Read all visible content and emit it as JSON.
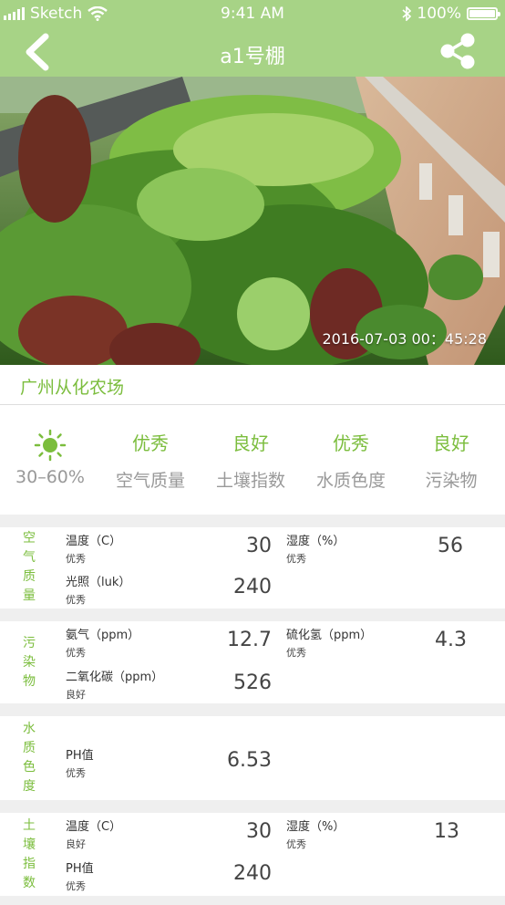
{
  "status": {
    "carrier": "Sketch",
    "time": "9:41 AM",
    "battery": "100%"
  },
  "nav": {
    "title": "a1号棚"
  },
  "hero": {
    "timestamp": "2016-07-03 00：45:28"
  },
  "farm": {
    "name": "广州从化农场"
  },
  "summary": {
    "items": [
      {
        "top_icon": "sun-icon",
        "bottom": "30–60%"
      },
      {
        "top": "优秀",
        "bottom": "空气质量"
      },
      {
        "top": "良好",
        "bottom": "土壤指数"
      },
      {
        "top": "优秀",
        "bottom": "水质色度"
      },
      {
        "top": "良好",
        "bottom": "污染物"
      }
    ]
  },
  "sections": [
    {
      "label": [
        "空",
        "气",
        "质",
        "量"
      ],
      "rows": [
        {
          "left": {
            "label": "温度（C）",
            "status": "优秀",
            "value": "30"
          },
          "right": {
            "label": "湿度（%）",
            "status": "优秀",
            "value": "56"
          }
        },
        {
          "left": {
            "label": "光照（luk）",
            "status": "优秀",
            "value": "240"
          }
        }
      ]
    },
    {
      "label": [
        "污",
        "染",
        "物"
      ],
      "rows": [
        {
          "left": {
            "label": "氨气（ppm）",
            "status": "优秀",
            "value": "12.7"
          },
          "right": {
            "label": "硫化氢（ppm）",
            "status": "优秀",
            "value": "4.3"
          }
        },
        {
          "left": {
            "label": "二氧化碳（ppm）",
            "status": "良好",
            "value": "526"
          }
        }
      ]
    },
    {
      "label": [
        "水",
        "质",
        "色",
        "度"
      ],
      "rows": [
        {
          "left": {
            "label": "PH值",
            "status": "优秀",
            "value": "6.53"
          }
        }
      ]
    },
    {
      "label": [
        "土",
        "壤",
        "指",
        "数"
      ],
      "rows": [
        {
          "left": {
            "label": "温度（C）",
            "status": "良好",
            "value": "30"
          },
          "right": {
            "label": "湿度（%）",
            "status": "优秀",
            "value": "13"
          }
        },
        {
          "left": {
            "label": "PH值",
            "status": "优秀",
            "value": "240"
          }
        }
      ]
    }
  ],
  "colors": {
    "header": "#a7d386",
    "accent": "#7bbd3d",
    "divider": "#efefef"
  }
}
